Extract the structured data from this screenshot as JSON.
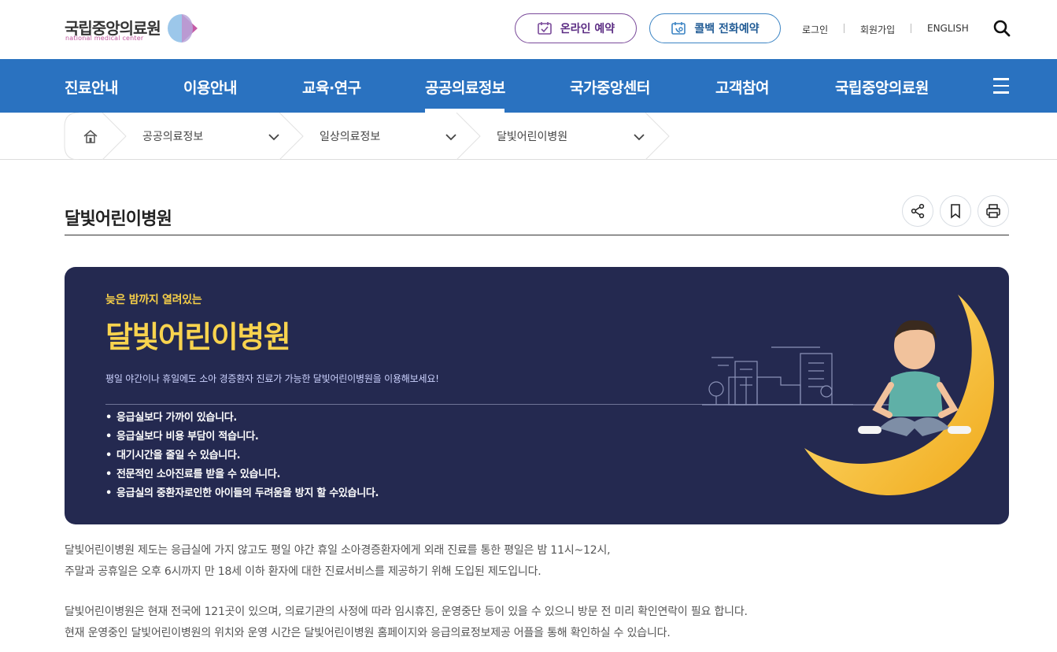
{
  "header": {
    "logo_text": "국립중앙의료원",
    "logo_sub": "national medical center",
    "online_reservation": "온라인 예약",
    "callback_reservation": "콜백 전화예약",
    "login": "로그인",
    "signup": "회원가입",
    "english": "ENGLISH",
    "search_icon": "search-icon"
  },
  "nav": {
    "items": [
      {
        "label": "진료안내"
      },
      {
        "label": "이용안내"
      },
      {
        "label": "교육·연구"
      },
      {
        "label": "공공의료정보"
      },
      {
        "label": "국가중앙센터"
      },
      {
        "label": "고객참여"
      },
      {
        "label": "국립중앙의료원"
      }
    ],
    "active_index": 3,
    "menu_icon": "hamburger-icon",
    "bar_color": "#2a72c0"
  },
  "breadcrumb": {
    "home_icon": "home-icon",
    "items": [
      {
        "label": "공공의료정보"
      },
      {
        "label": "일상의료정보"
      },
      {
        "label": "달빛어린이병원"
      }
    ]
  },
  "page": {
    "title": "달빛어린이병원",
    "tools": [
      "share-icon",
      "bookmark-icon",
      "print-icon"
    ]
  },
  "banner": {
    "subtitle": "늦은 밤까지 열려있는",
    "title": "달빛어린이병원",
    "description": "평일 야간이나 휴일에도 소아 경증환자 진료가 가능한 달빛어린이병원을 이용해보세요!",
    "bullets": [
      "응급실보다 가까이 있습니다.",
      "응급실보다 비용 부담이 적습니다.",
      "대기시간을 줄일 수 있습니다.",
      "전문적인 소아진료를 받을 수 있습니다.",
      "응급실의 중환자로인한 아이들의 두려움을 방지 할 수있습니다."
    ],
    "background_color": "#242950",
    "accent_color": "#f8d34e"
  },
  "body": {
    "paragraphs": [
      "달빛어린이병원 제도는 응급실에 가지 않고도 평일 야간 휴일 소아경증환자에게 외래 진료를 통한 평일은 밤 11시~12시,",
      "주말과 공휴일은 오후 6시까지 만 18세 이하 환자에 대한 진료서비스를 제공하기 위해 도입된 제도입니다.",
      "달빛어린이병원은 현재 전국에 121곳이 있으며, 의료기관의 사정에 따라 임시휴진, 운영중단 등이 있을 수 있으니 방문 전 미리 확인연락이 필요 합니다.",
      "현재 운영중인 달빛어린이병원의 위치와 운영 시간은 달빛어린이병원 홈페이지와 응급의료정보제공 어플을 통해 확인하실 수 있습니다."
    ]
  }
}
